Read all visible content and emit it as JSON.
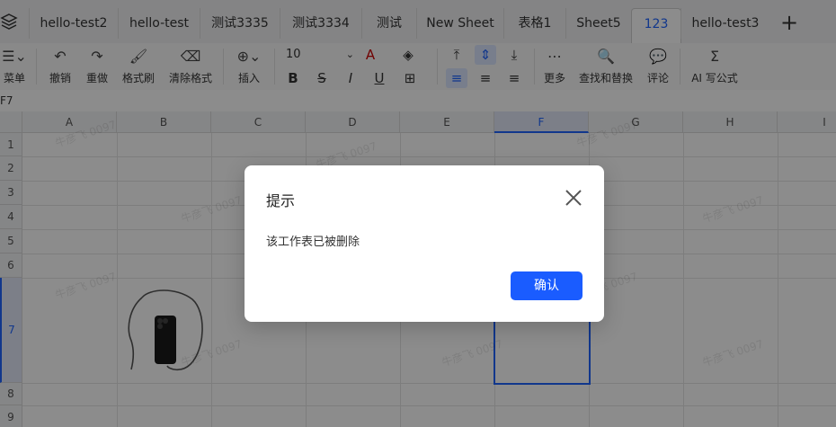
{
  "tabs": [
    {
      "label": "hello-test2",
      "active": false
    },
    {
      "label": "hello-test",
      "active": false
    },
    {
      "label": "测试3335",
      "active": false
    },
    {
      "label": "测试3334",
      "active": false
    },
    {
      "label": "测试",
      "active": false
    },
    {
      "label": "New Sheet",
      "active": false
    },
    {
      "label": "表格1",
      "active": false
    },
    {
      "label": "Sheet5",
      "active": false
    },
    {
      "label": "123",
      "active": true
    },
    {
      "label": "hello-test3",
      "active": false
    }
  ],
  "toolbar": {
    "menu_label": "菜单",
    "undo_label": "撤销",
    "redo_label": "重做",
    "format_painter_label": "格式刷",
    "clear_format_label": "清除格式",
    "insert_label": "插入",
    "font_size": "10",
    "more_label": "更多",
    "find_replace_label": "查找和替换",
    "comment_label": "评论",
    "ai_formula_label": "AI 写公式"
  },
  "name_box": "F7",
  "columns": [
    "A",
    "B",
    "C",
    "D",
    "E",
    "F",
    "G",
    "H",
    "I"
  ],
  "rows": [
    "1",
    "2",
    "3",
    "4",
    "5",
    "6",
    "7",
    "8",
    "9"
  ],
  "selected_column": "F",
  "watermark": "牛彦飞 0097",
  "dialog": {
    "title": "提示",
    "message": "该工作表已被删除",
    "confirm_label": "确认"
  },
  "colors": {
    "accent": "#1a5cff",
    "overlay": "rgba(0,0,0,0.45)"
  }
}
